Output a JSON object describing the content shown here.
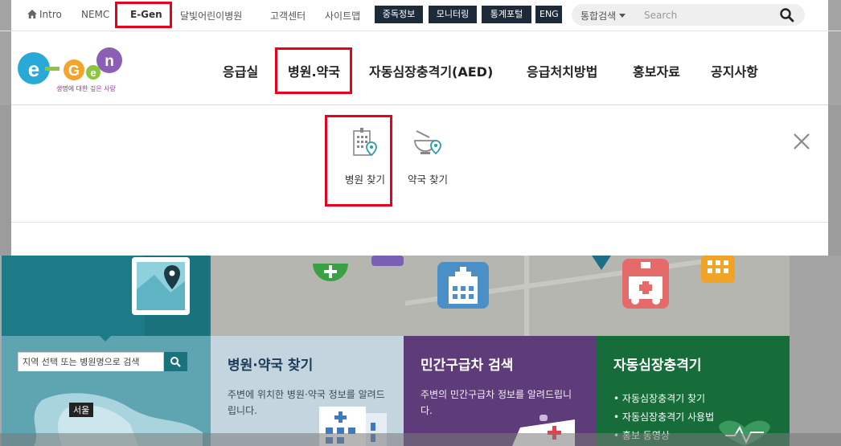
{
  "top_util": {
    "home": "Intro",
    "nemc": "NEMC",
    "egen": "E-Gen",
    "dalbit": "달빛어린이병원",
    "customer": "고객센터",
    "sitemap": "사이트맵",
    "buttons": [
      "중독정보",
      "모니터링",
      "통계포털",
      "ENG"
    ],
    "search_scope": "통합검색",
    "search_placeholder": "Search"
  },
  "logo": {
    "text": "E-Gen",
    "tagline": "생명에 대한 깊은 사랑"
  },
  "nav": {
    "items": [
      "응급실",
      "병원.약국",
      "자동심장충격기(AED)",
      "응급처치방법",
      "홍보자료",
      "공지사항"
    ]
  },
  "submenu": {
    "items": [
      "병원 찾기",
      "약국 찾기"
    ]
  },
  "region": {
    "search_placeholder": "지역 선택 또는 병원명으로 검색",
    "seoul": "서울"
  },
  "cards": {
    "hospital": {
      "title": "병원·약국 찾기",
      "desc": "주변에 위치한 병원·약국 정보를 알려드립니다."
    },
    "ambulance": {
      "title": "민간구급차 검색",
      "desc": "주변의 민간구급차 정보를 알려드립니다."
    },
    "aed": {
      "title": "자동심장충격기",
      "items": [
        "자동심장충격기 찾기",
        "자동심장충격기 사용법",
        "홍보 동영상"
      ]
    }
  },
  "colors": {
    "dark_button": "#1c2a3a",
    "highlight": "#e8001c",
    "teal": "#1c7b86",
    "purple": "#5e3c7a",
    "green": "#176d3a"
  }
}
